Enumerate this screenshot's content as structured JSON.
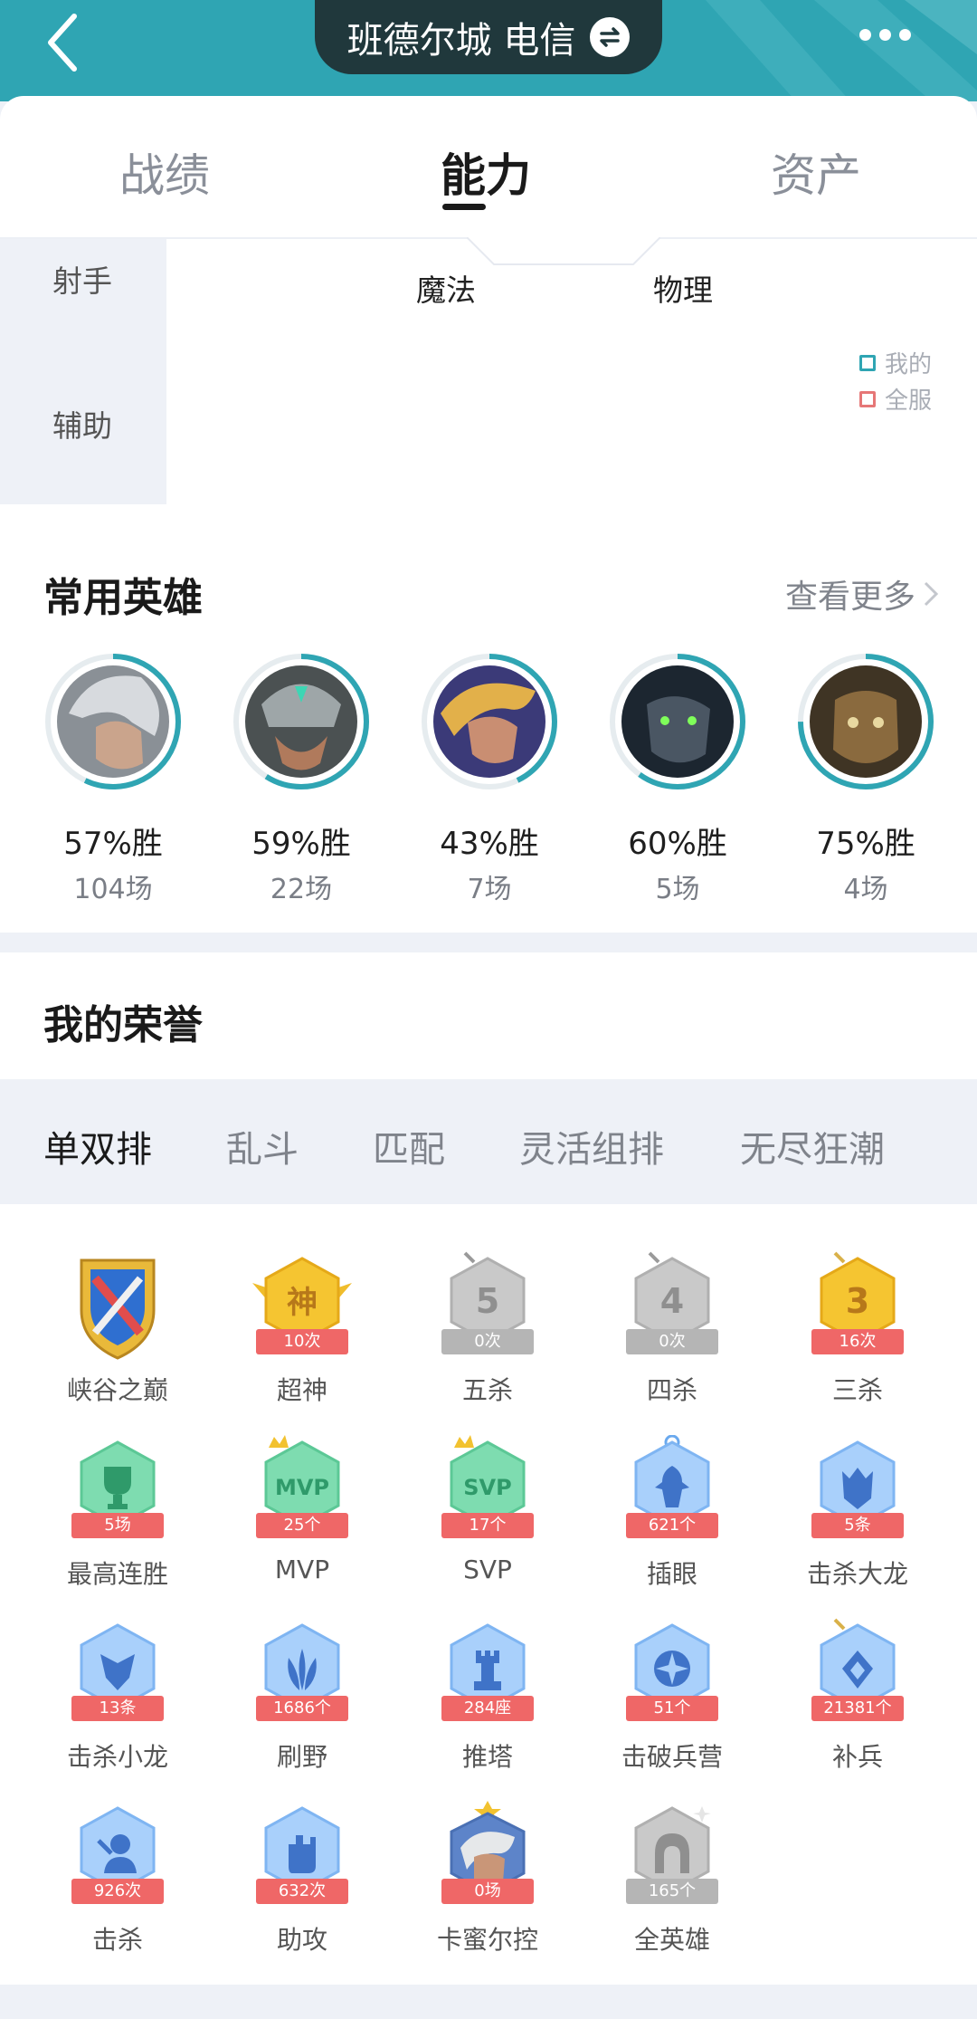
{
  "header": {
    "server": "班德尔城 电信"
  },
  "tabs": [
    {
      "label": "战绩"
    },
    {
      "label": "能力"
    },
    {
      "label": "资产"
    }
  ],
  "radar": {
    "left_labels": [
      "射手",
      "辅助"
    ],
    "axis_labels": [
      "魔法",
      "物理"
    ],
    "legend": [
      "我的",
      "全服"
    ]
  },
  "heroes": {
    "title": "常用英雄",
    "see_more": "查看更多",
    "items": [
      {
        "rate": "57%胜",
        "games": "104场"
      },
      {
        "rate": "59%胜",
        "games": "22场"
      },
      {
        "rate": "43%胜",
        "games": "7场"
      },
      {
        "rate": "60%胜",
        "games": "5场"
      },
      {
        "rate": "75%胜",
        "games": "4场"
      }
    ]
  },
  "honor": {
    "title": "我的荣誉",
    "modes": [
      "单双排",
      "乱斗",
      "匹配",
      "灵活组排",
      "无尽狂潮"
    ],
    "badges": [
      {
        "label": "峡谷之巅",
        "count": ""
      },
      {
        "label": "超神",
        "count": "10次",
        "glyph": "神"
      },
      {
        "label": "五杀",
        "count": "0次",
        "glyph": "5"
      },
      {
        "label": "四杀",
        "count": "0次",
        "glyph": "4"
      },
      {
        "label": "三杀",
        "count": "16次",
        "glyph": "3"
      },
      {
        "label": "最高连胜",
        "count": "5场"
      },
      {
        "label": "MVP",
        "count": "25个",
        "glyph": "MVP"
      },
      {
        "label": "SVP",
        "count": "17个",
        "glyph": "SVP"
      },
      {
        "label": "插眼",
        "count": "621个"
      },
      {
        "label": "击杀大龙",
        "count": "5条"
      },
      {
        "label": "击杀小龙",
        "count": "13条"
      },
      {
        "label": "刷野",
        "count": "1686个"
      },
      {
        "label": "推塔",
        "count": "284座"
      },
      {
        "label": "击破兵营",
        "count": "51个"
      },
      {
        "label": "补兵",
        "count": "21381个"
      },
      {
        "label": "击杀",
        "count": "926次"
      },
      {
        "label": "助攻",
        "count": "632次"
      },
      {
        "label": "卡蜜尔控",
        "count": "0场"
      },
      {
        "label": "全英雄",
        "count": "165个"
      }
    ]
  }
}
